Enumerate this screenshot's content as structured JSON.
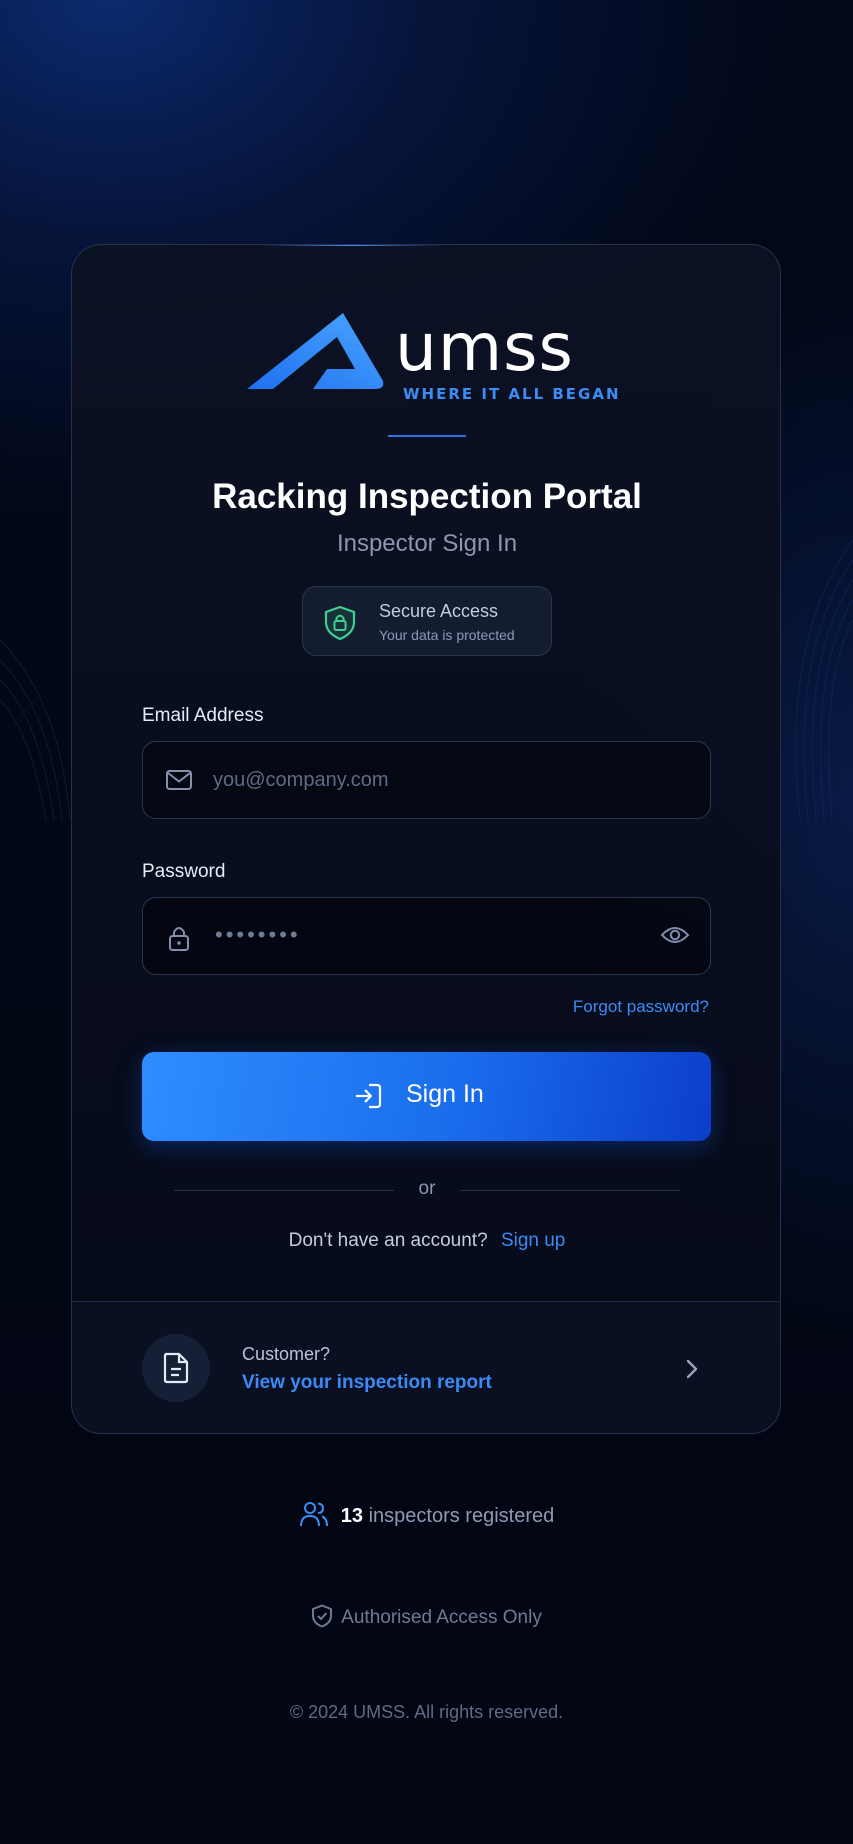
{
  "brand": {
    "wordmark": "umss",
    "tagline": "WHERE IT ALL BEGAN"
  },
  "header": {
    "title": "Racking Inspection Portal",
    "subtitle": "Inspector Sign In"
  },
  "secure_badge": {
    "title": "Secure Access",
    "subtitle": "Your data is protected"
  },
  "form": {
    "email_label": "Email Address",
    "email_placeholder": "you@company.com",
    "email_value": "",
    "password_label": "Password",
    "password_masked": "••••••••",
    "forgot_link": "Forgot password?",
    "submit_label": "Sign In"
  },
  "separator": {
    "text": "or"
  },
  "signup": {
    "prompt": "Don't have an account?",
    "link": "Sign up"
  },
  "customer_panel": {
    "question": "Customer?",
    "link": "View your inspection report"
  },
  "stats": {
    "count": "13",
    "suffix": "inspectors registered"
  },
  "footer": {
    "notice": "Authorised Access Only",
    "copyright": "© 2024 UMSS. All rights reserved."
  },
  "colors": {
    "accent": "#3a8bf5",
    "button_start": "#2e8dff",
    "button_end": "#0b3ecb",
    "shield_green": "#3ecf8e",
    "background": "#030818"
  },
  "icons": {
    "logo": "umss-mountain-logo",
    "secure": "shield-lock-icon",
    "email": "mail-icon",
    "password": "lock-icon",
    "toggle": "eye-icon",
    "submit": "sign-in-icon",
    "customer": "document-icon",
    "customer_arrow": "chevron-right-icon",
    "stats": "users-icon",
    "notice": "shield-check-icon"
  }
}
